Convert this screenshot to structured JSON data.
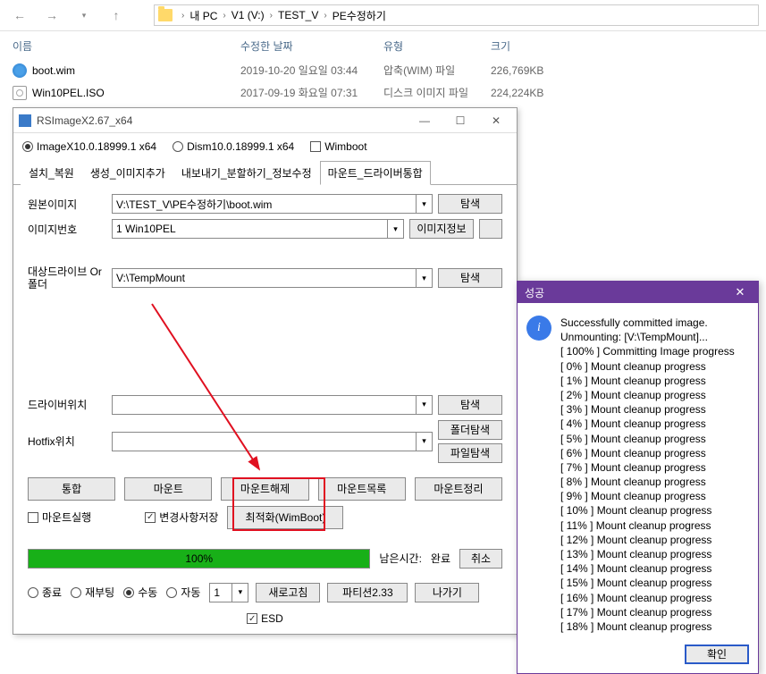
{
  "explorer": {
    "crumbs": [
      "내 PC",
      "V1 (V:)",
      "TEST_V",
      "PE수정하기"
    ],
    "columns": {
      "name": "이름",
      "date": "수정한 날짜",
      "type": "유형",
      "size": "크기"
    },
    "files": [
      {
        "name": "boot.wim",
        "date": "2019-10-20 일요일 03:44",
        "type": "압축(WIM) 파일",
        "size": "226,769KB",
        "icon": "wim"
      },
      {
        "name": "Win10PEL.ISO",
        "date": "2017-09-19 화요일 07:31",
        "type": "디스크 이미지 파일",
        "size": "224,224KB",
        "icon": "iso"
      }
    ]
  },
  "rsix": {
    "title": "RSImageX2.67_x64",
    "modes": {
      "imagex": "ImageX10.0.18999.1 x64",
      "dism": "Dism10.0.18999.1 x64",
      "wimboot": "Wimboot"
    },
    "tabs": [
      "설치_복원",
      "생성_이미지추가",
      "내보내기_분할하기_정보수정",
      "마운트_드라이버통합"
    ],
    "active_tab": 3,
    "fields": {
      "source_label": "원본이미지",
      "source_value": "V:\\TEST_V\\PE수정하기\\boot.wim",
      "index_label": "이미지번호",
      "index_value": "1  Win10PEL",
      "target_label": "대상드라이브 Or 폴더",
      "target_value": "V:\\TempMount",
      "driver_label": "드라이버위치",
      "hotfix_label": "Hotfix위치",
      "browse": "탐색",
      "imginfo": "이미지정보",
      "folder_browse": "폴더탐색",
      "file_browse": "파일탐색"
    },
    "buttons": {
      "integrate": "통합",
      "mount": "마운트",
      "unmount": "마운트해제",
      "mount_list": "마운트목록",
      "mount_clean": "마운트정리",
      "mount_exec": "마운트실행",
      "save_changes": "변경사항저장",
      "optimize": "최적화(WimBoot)"
    },
    "progress": {
      "pct": "100%",
      "remain_label": "남은시간:",
      "remain": "완료",
      "cancel": "취소"
    },
    "bottom": {
      "shutdown": "종료",
      "reboot": "재부팅",
      "manual": "수동",
      "auto": "자동",
      "num": "1",
      "refresh": "새로고침",
      "partition": "파티션2.33",
      "exit": "나가기",
      "esd": "ESD"
    }
  },
  "success": {
    "title": "성공",
    "lines": [
      "Successfully committed image.",
      "Unmounting: [V:\\TempMount]...",
      "[ 100% ] Committing Image progress",
      "[  0% ] Mount cleanup progress",
      "[  1% ] Mount cleanup progress",
      "[  2% ] Mount cleanup progress",
      "[  3% ] Mount cleanup progress",
      "[  4% ] Mount cleanup progress",
      "[  5% ] Mount cleanup progress",
      "[  6% ] Mount cleanup progress",
      "[  7% ] Mount cleanup progress",
      "[  8% ] Mount cleanup progress",
      "[  9% ] Mount cleanup progress",
      "[  10% ] Mount cleanup progress",
      "[  11% ] Mount cleanup progress",
      "[  12% ] Mount cleanup progress",
      "[  13% ] Mount cleanup progress",
      "[  14% ] Mount cleanup progress",
      "[  15% ] Mount cleanup progress",
      "[  16% ] Mount cleanup progress",
      "[  17% ] Mount cleanup progress",
      "[  18% ] Mount cleanup progress"
    ],
    "ok": "확인"
  }
}
